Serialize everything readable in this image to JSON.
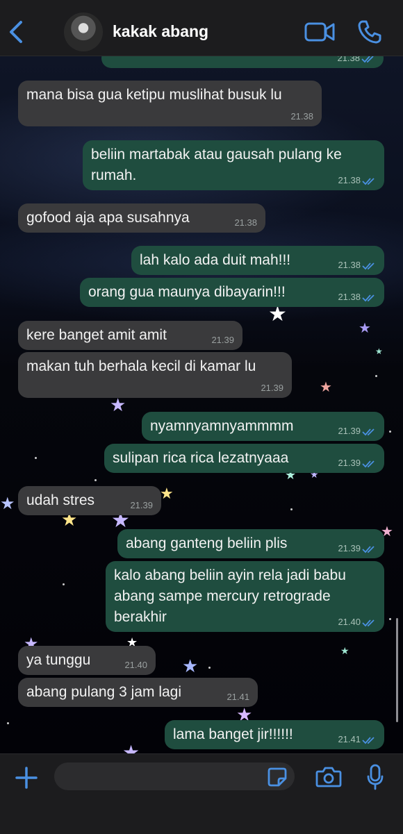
{
  "header": {
    "contact_name": "kakak abang",
    "icons": {
      "back": "chevron-left-icon",
      "video": "video-camera-icon",
      "call": "phone-icon"
    },
    "accent_color": "#4a90e2"
  },
  "messages": [
    {
      "side": "out",
      "text": "",
      "time": "21.38",
      "read": true
    },
    {
      "side": "in",
      "text": "mana bisa gua ketipu muslihat busuk lu",
      "time": "21.38"
    },
    {
      "side": "out",
      "text": "beliin martabak atau gausah pulang ke rumah.",
      "time": "21.38",
      "read": true
    },
    {
      "side": "in",
      "text": "gofood aja apa susahnya",
      "time": "21.38"
    },
    {
      "side": "out",
      "text": "lah kalo ada duit mah!!!",
      "time": "21.38",
      "read": true
    },
    {
      "side": "out",
      "text": "orang gua maunya dibayarin!!!",
      "time": "21.38",
      "read": true
    },
    {
      "side": "in",
      "text": "kere banget amit amit",
      "time": "21.39"
    },
    {
      "side": "in",
      "text": "makan tuh berhala kecil di kamar lu",
      "time": "21.39"
    },
    {
      "side": "out",
      "text": "nyamnyamnyammmm",
      "time": "21.39",
      "read": true
    },
    {
      "side": "out",
      "text": "sulipan rica rica lezatnyaaa",
      "time": "21.39",
      "read": true
    },
    {
      "side": "in",
      "text": "udah stres",
      "time": "21.39"
    },
    {
      "side": "out",
      "text": "abang ganteng beliin plis",
      "time": "21.39",
      "read": true
    },
    {
      "side": "out",
      "text": "kalo abang beliin ayin rela jadi babu abang sampe mercury retrograde berakhir",
      "time": "21.40",
      "read": true
    },
    {
      "side": "in",
      "text": "ya tunggu",
      "time": "21.40"
    },
    {
      "side": "in",
      "text": "abang pulang 3 jam lagi",
      "time": "21.41"
    },
    {
      "side": "out",
      "text": "lama banget jir!!!!!!",
      "time": "21.41",
      "read": true
    }
  ],
  "input_bar": {
    "placeholder": "",
    "icons": {
      "add": "plus-icon",
      "sticker": "sticker-icon",
      "camera": "camera-icon",
      "mic": "microphone-icon"
    }
  },
  "colors": {
    "incoming_bubble": "#3a3a3c",
    "outgoing_bubble": "#1f4d3f",
    "read_tick": "#4a90e2"
  }
}
